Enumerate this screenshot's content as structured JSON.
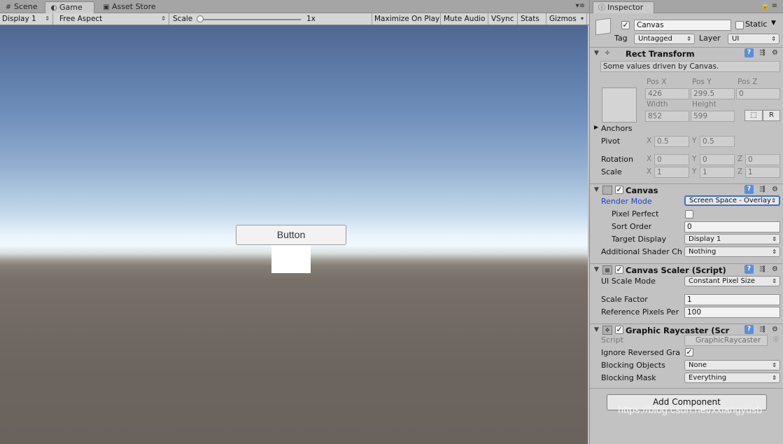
{
  "tabs": {
    "scene": "Scene",
    "game": "Game",
    "asset_store": "Asset Store",
    "inspector": "Inspector"
  },
  "toolbar": {
    "display": "Display 1",
    "aspect": "Free Aspect",
    "scale_label": "Scale",
    "scale_value": "1x",
    "maximize": "Maximize On Play",
    "mute": "Mute Audio",
    "vsync": "VSync",
    "stats": "Stats",
    "gizmos": "Gizmos"
  },
  "game": {
    "button_text": "Button"
  },
  "object": {
    "name": "Canvas",
    "active": true,
    "static_label": "Static",
    "tag_label": "Tag",
    "tag": "Untagged",
    "layer_label": "Layer",
    "layer": "UI"
  },
  "rect_transform": {
    "title": "Rect Transform",
    "note": "Some values driven by Canvas.",
    "pos_x_label": "Pos X",
    "pos_y_label": "Pos Y",
    "pos_z_label": "Pos Z",
    "pos_x": "426",
    "pos_y": "299.5",
    "pos_z": "0",
    "width_label": "Width",
    "height_label": "Height",
    "width": "852",
    "height": "599",
    "r_button": "R",
    "anchors_label": "Anchors",
    "pivot_label": "Pivot",
    "pivot_x": "0.5",
    "pivot_y": "0.5",
    "rotation_label": "Rotation",
    "rot_x": "0",
    "rot_y": "0",
    "rot_z": "0",
    "scale_label": "Scale",
    "scale_x": "1",
    "scale_y": "1",
    "scale_z": "1",
    "axis_x": "X",
    "axis_y": "Y",
    "axis_z": "Z"
  },
  "canvas": {
    "title": "Canvas",
    "render_mode_label": "Render Mode",
    "render_mode": "Screen Space - Overlay",
    "pixel_perfect_label": "Pixel Perfect",
    "sort_order_label": "Sort Order",
    "sort_order": "0",
    "target_display_label": "Target Display",
    "target_display": "Display 1",
    "shader_channels_label": "Additional Shader Ch",
    "shader_channels": "Nothing"
  },
  "canvas_scaler": {
    "title": "Canvas Scaler (Script)",
    "ui_scale_mode_label": "UI Scale Mode",
    "ui_scale_mode": "Constant Pixel Size",
    "scale_factor_label": "Scale Factor",
    "scale_factor": "1",
    "ref_ppu_label": "Reference Pixels Per",
    "ref_ppu": "100"
  },
  "graphic_raycaster": {
    "title": "Graphic Raycaster (Scr",
    "script_label": "Script",
    "script": "GraphicRaycaster",
    "ignore_reversed_label": "Ignore Reversed Gra",
    "blocking_objects_label": "Blocking Objects",
    "blocking_objects": "None",
    "blocking_mask_label": "Blocking Mask",
    "blocking_mask": "Everything"
  },
  "add_component": "Add Component",
  "watermark": "https://blog.csdn.net/xxiangyusb"
}
